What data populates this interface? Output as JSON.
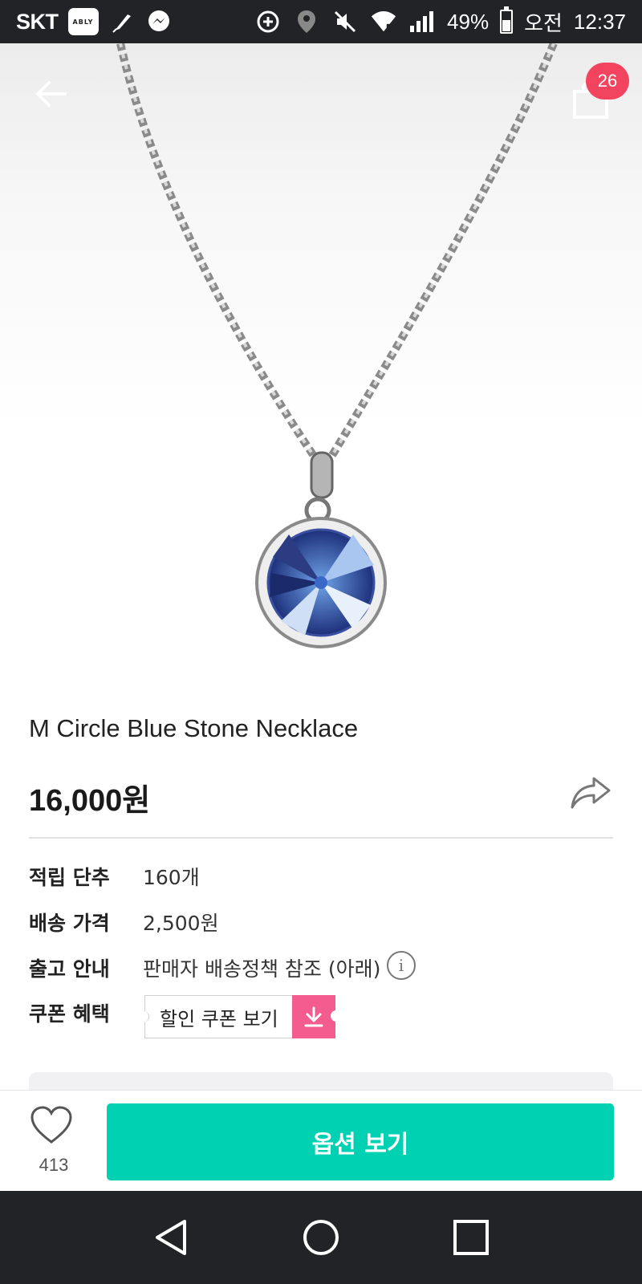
{
  "status_bar": {
    "carrier": "SKT",
    "app_badge": "ABLY",
    "battery": "49%",
    "ampm": "오전",
    "time": "12:37"
  },
  "header": {
    "cart_count": "26"
  },
  "product": {
    "title": "M Circle Blue Stone Necklace",
    "price": "16,000원"
  },
  "details": {
    "points_label": "적립 단추",
    "points_value": "160개",
    "shipping_label": "배송 가격",
    "shipping_value": "2,500원",
    "release_label": "출고 안내",
    "release_value": "판매자 배송정책 참조 (아래)",
    "coupon_label": "쿠폰 혜택",
    "coupon_button": "할인 쿠폰 보기"
  },
  "action_bar": {
    "like_count": "413",
    "options_button": "옵션 보기"
  },
  "colors": {
    "accent": "#00d1b2",
    "badge": "#f2445e",
    "coupon": "#f45b8e",
    "system_bar": "#222326"
  },
  "icons": [
    "back-arrow-icon",
    "cart-icon",
    "share-icon",
    "info-icon",
    "download-icon",
    "heart-icon",
    "nav-back-icon",
    "nav-home-icon",
    "nav-recents-icon"
  ]
}
